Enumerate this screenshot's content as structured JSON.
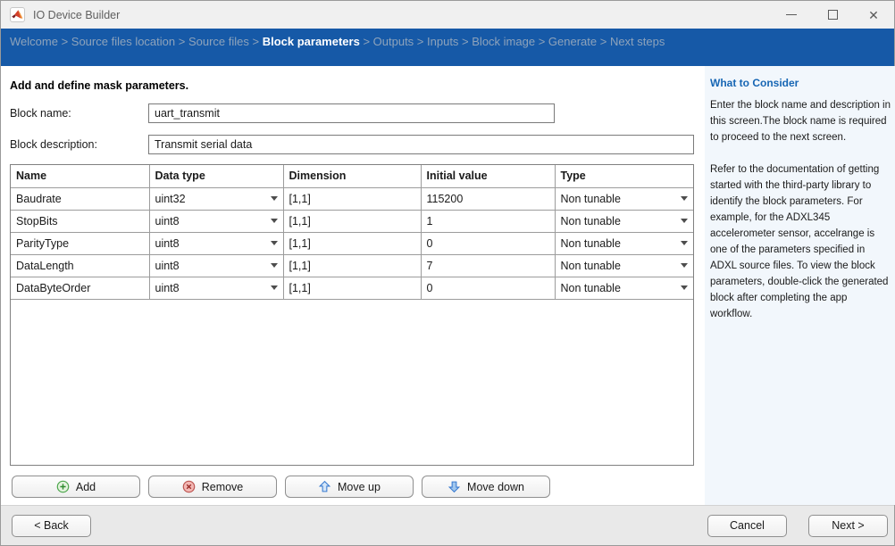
{
  "colors": {
    "accent_blue": "#1659A7",
    "breadcrumb_inactive": "#8EA3BB",
    "sidebar_bg": "#F2F7FC",
    "sidebar_heading_blue": "#1766B4",
    "add_green": "#4CA64C",
    "remove_red": "#BC5551",
    "arrow_blue": "#3A7BD0"
  },
  "window": {
    "title": "IO Device Builder",
    "control_icons": [
      "minimize-icon",
      "maximize-icon",
      "close-icon"
    ]
  },
  "breadcrumb": {
    "separator": ">",
    "steps": [
      {
        "label": "Welcome",
        "active": false
      },
      {
        "label": "Source files location",
        "active": false
      },
      {
        "label": "Source files",
        "active": false
      },
      {
        "label": "Block parameters",
        "active": true
      },
      {
        "label": "Outputs",
        "active": false
      },
      {
        "label": "Inputs",
        "active": false
      },
      {
        "label": "Block image",
        "active": false
      },
      {
        "label": "Generate",
        "active": false
      },
      {
        "label": "Next steps",
        "active": false
      }
    ]
  },
  "main": {
    "heading": "Add and define mask parameters.",
    "fields": [
      {
        "label": "Block name:",
        "value": "uart_transmit"
      },
      {
        "label": "Block description:",
        "value": "Transmit serial data"
      }
    ],
    "table": {
      "columns": [
        "Name",
        "Data type",
        "Dimension",
        "Initial value",
        "Type"
      ],
      "rows": [
        {
          "name": "Baudrate",
          "data_type": "uint32",
          "dimension": "[1,1]",
          "initial_value": "115200",
          "type": "Non tunable"
        },
        {
          "name": "StopBits",
          "data_type": "uint8",
          "dimension": "[1,1]",
          "initial_value": "1",
          "type": "Non tunable"
        },
        {
          "name": "ParityType",
          "data_type": "uint8",
          "dimension": "[1,1]",
          "initial_value": "0",
          "type": "Non tunable"
        },
        {
          "name": "DataLength",
          "data_type": "uint8",
          "dimension": "[1,1]",
          "initial_value": "7",
          "type": "Non tunable"
        },
        {
          "name": "DataByteOrder",
          "data_type": "uint8",
          "dimension": "[1,1]",
          "initial_value": "0",
          "type": "Non tunable"
        }
      ]
    },
    "actions": [
      {
        "label": "Add",
        "icon": "add-circle-plus-icon"
      },
      {
        "label": "Remove",
        "icon": "remove-circle-x-icon"
      },
      {
        "label": "Move up",
        "icon": "arrow-up-icon"
      },
      {
        "label": "Move down",
        "icon": "arrow-down-icon"
      }
    ]
  },
  "sidebar": {
    "title": "What to Consider",
    "paragraphs": [
      "Enter the block name and description in this screen.The block name is required to proceed to the next screen.",
      "Refer to the documentation of getting started with the third-party library to identify the block parameters. For example, for the ADXL345 accelerometer sensor, accelrange is one of the parameters specified in ADXL source files. To view the block parameters, double-click the generated block after completing the app workflow."
    ]
  },
  "footer": {
    "back_label": "< Back",
    "cancel_label": "Cancel",
    "next_label": "Next >"
  }
}
